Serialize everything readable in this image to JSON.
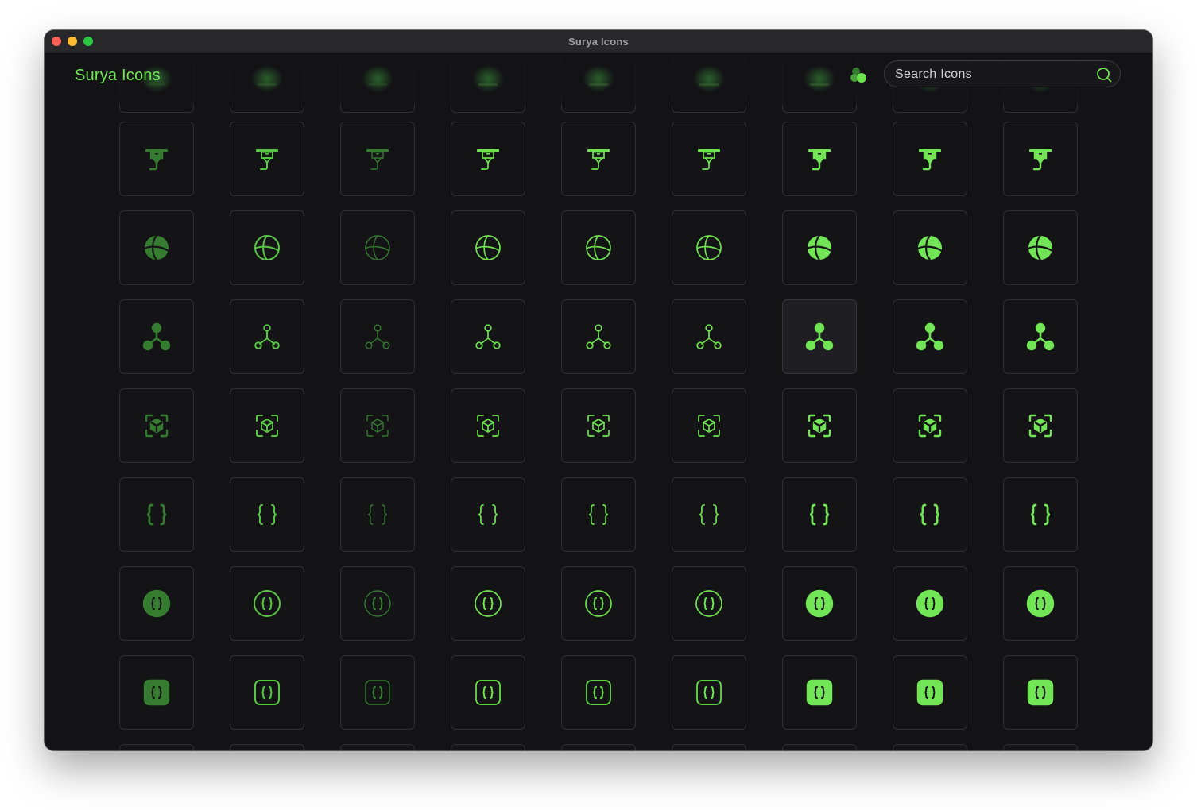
{
  "window": {
    "title": "Surya Icons"
  },
  "app": {
    "title": "Surya Icons",
    "search": {
      "placeholder": "Search Icons",
      "value": ""
    }
  },
  "colors": {
    "accent": "#6fe24f",
    "accent_light": "#72e556",
    "accent_mid": "#58c545",
    "accent_dark": "#357c31",
    "tile_border": "#2f2f34",
    "background": "#131316"
  },
  "icon_grid": {
    "columns": 9,
    "variant_styles": [
      "bulk",
      "duotone",
      "light",
      "linear",
      "outline",
      "broken",
      "bold",
      "solid",
      "twotone"
    ],
    "rows": [
      {
        "icon": "cube-3d-printer-icon",
        "partial": "top"
      },
      {
        "icon": "3d-printer-icon"
      },
      {
        "icon": "sphere-globe-icon"
      },
      {
        "icon": "node-network-icon",
        "hovered_column": 6
      },
      {
        "icon": "ar-cube-scan-icon"
      },
      {
        "icon": "braces-code-icon"
      },
      {
        "icon": "braces-circle-icon"
      },
      {
        "icon": "braces-square-icon"
      },
      {
        "icon": "next-row-icon",
        "partial": "bottom"
      }
    ]
  }
}
